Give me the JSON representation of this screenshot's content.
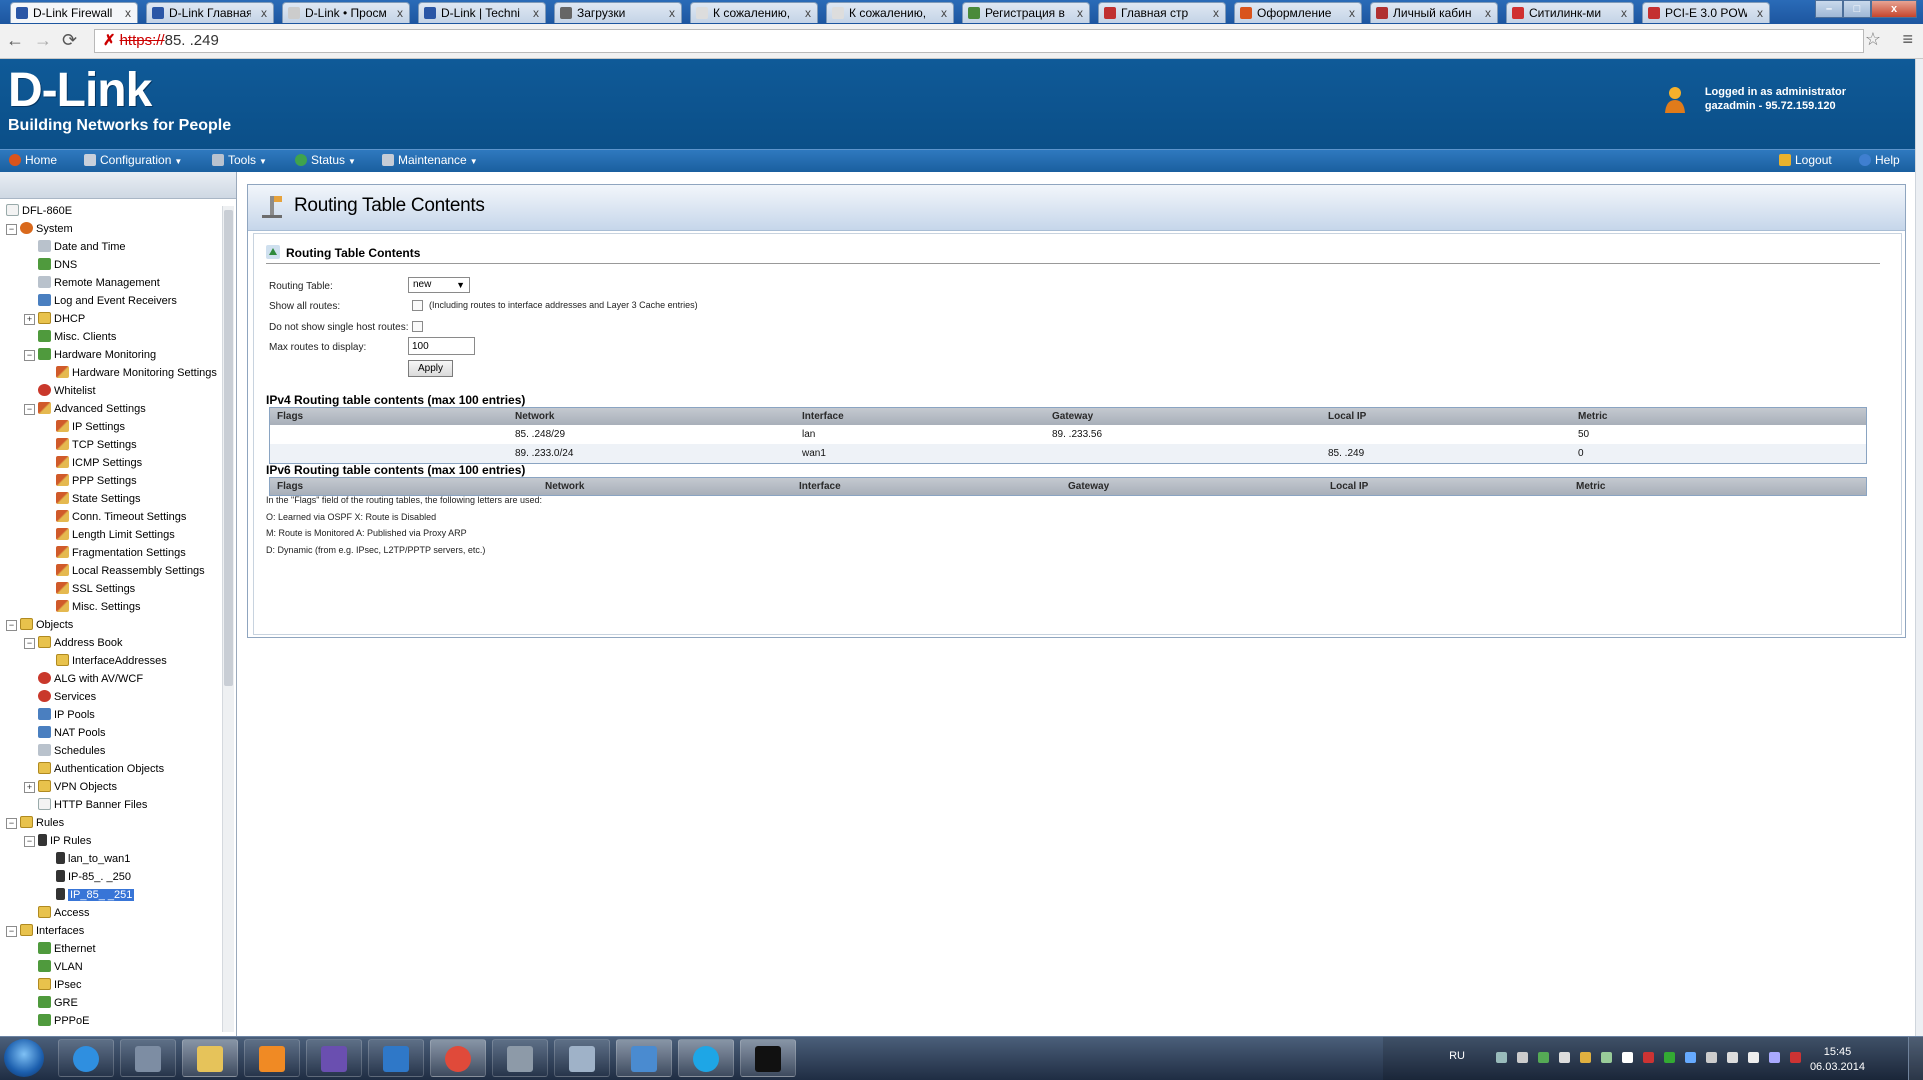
{
  "browser": {
    "tabs": [
      {
        "label": "D-Link Firewall",
        "active": true
      },
      {
        "label": "D-Link Главная"
      },
      {
        "label": "D-Link • Просм"
      },
      {
        "label": "D-Link | Techni"
      },
      {
        "label": "Загрузки"
      },
      {
        "label": "К сожалению,"
      },
      {
        "label": "К сожалению,"
      },
      {
        "label": "Регистрация в"
      },
      {
        "label": "Главная стр"
      },
      {
        "label": "Оформление"
      },
      {
        "label": "Личный кабин"
      },
      {
        "label": "Ситилинк-ми"
      },
      {
        "label": "PCI-E 3.0 POW"
      }
    ],
    "url_scheme": "https://",
    "url_host": "85.       .249",
    "close_glyph": "x",
    "win_min": "–",
    "win_max": "□",
    "win_close": "x"
  },
  "header": {
    "logo": "D-Link",
    "tagline": "Building Networks for People",
    "logged_in": "Logged in as administrator",
    "session": "gazadmin - 95.72.159.120"
  },
  "nav": {
    "home": "Home",
    "configuration": "Configuration",
    "tools": "Tools",
    "status": "Status",
    "maintenance": "Maintenance",
    "logout": "Logout",
    "help": "Help"
  },
  "tree": {
    "items": [
      {
        "label": "DFL-860E",
        "level": 0,
        "toggle": "",
        "icon": "icdoc"
      },
      {
        "label": "System",
        "level": 0,
        "toggle": "−",
        "icon": "icw"
      },
      {
        "label": "Date and Time",
        "level": 1,
        "toggle": "",
        "icon": "icg"
      },
      {
        "label": "DNS",
        "level": 1,
        "toggle": "",
        "icon": "icgr"
      },
      {
        "label": "Remote Management",
        "level": 1,
        "toggle": "",
        "icon": "icg"
      },
      {
        "label": "Log and Event Receivers",
        "level": 1,
        "toggle": "",
        "icon": "icb"
      },
      {
        "label": "DHCP",
        "level": 1,
        "toggle": "+",
        "icon": "icf"
      },
      {
        "label": "Misc. Clients",
        "level": 1,
        "toggle": "",
        "icon": "icgr"
      },
      {
        "label": "Hardware Monitoring",
        "level": 1,
        "toggle": "−",
        "icon": "icgr"
      },
      {
        "label": "Hardware Monitoring Settings",
        "level": 2,
        "toggle": "",
        "icon": "ics"
      },
      {
        "label": "Whitelist",
        "level": 1,
        "toggle": "",
        "icon": "icr"
      },
      {
        "label": "Advanced Settings",
        "level": 1,
        "toggle": "−",
        "icon": "ics"
      },
      {
        "label": "IP Settings",
        "level": 2,
        "toggle": "",
        "icon": "ics"
      },
      {
        "label": "TCP Settings",
        "level": 2,
        "toggle": "",
        "icon": "ics"
      },
      {
        "label": "ICMP Settings",
        "level": 2,
        "toggle": "",
        "icon": "ics"
      },
      {
        "label": "PPP Settings",
        "level": 2,
        "toggle": "",
        "icon": "ics"
      },
      {
        "label": "State Settings",
        "level": 2,
        "toggle": "",
        "icon": "ics"
      },
      {
        "label": "Conn. Timeout Settings",
        "level": 2,
        "toggle": "",
        "icon": "ics"
      },
      {
        "label": "Length Limit Settings",
        "level": 2,
        "toggle": "",
        "icon": "ics"
      },
      {
        "label": "Fragmentation Settings",
        "level": 2,
        "toggle": "",
        "icon": "ics"
      },
      {
        "label": "Local Reassembly Settings",
        "level": 2,
        "toggle": "",
        "icon": "ics"
      },
      {
        "label": "SSL Settings",
        "level": 2,
        "toggle": "",
        "icon": "ics"
      },
      {
        "label": "Misc. Settings",
        "level": 2,
        "toggle": "",
        "icon": "ics"
      },
      {
        "label": "Objects",
        "level": 0,
        "toggle": "−",
        "icon": "icf"
      },
      {
        "label": "Address Book",
        "level": 1,
        "toggle": "−",
        "icon": "icf"
      },
      {
        "label": "InterfaceAddresses",
        "level": 2,
        "toggle": "",
        "icon": "icf"
      },
      {
        "label": "ALG with AV/WCF",
        "level": 1,
        "toggle": "",
        "icon": "icr"
      },
      {
        "label": "Services",
        "level": 1,
        "toggle": "",
        "icon": "icr"
      },
      {
        "label": "IP Pools",
        "level": 1,
        "toggle": "",
        "icon": "icb"
      },
      {
        "label": "NAT Pools",
        "level": 1,
        "toggle": "",
        "icon": "icb"
      },
      {
        "label": "Schedules",
        "level": 1,
        "toggle": "",
        "icon": "icg"
      },
      {
        "label": "Authentication Objects",
        "level": 1,
        "toggle": "",
        "icon": "icf"
      },
      {
        "label": "VPN Objects",
        "level": 1,
        "toggle": "+",
        "icon": "icf"
      },
      {
        "label": "HTTP Banner Files",
        "level": 1,
        "toggle": "",
        "icon": "icdoc"
      },
      {
        "label": "Rules",
        "level": 0,
        "toggle": "−",
        "icon": "icf"
      },
      {
        "label": "IP Rules",
        "level": 1,
        "toggle": "−",
        "icon": "ictl"
      },
      {
        "label": "lan_to_wan1",
        "level": 2,
        "toggle": "",
        "icon": "ictl"
      },
      {
        "label": "IP-85_.       _250",
        "level": 2,
        "toggle": "",
        "icon": "ictl"
      },
      {
        "label": "IP_85_       _251",
        "level": 2,
        "toggle": "",
        "icon": "ictl",
        "selected": true
      },
      {
        "label": "Access",
        "level": 1,
        "toggle": "",
        "icon": "icf"
      },
      {
        "label": "Interfaces",
        "level": 0,
        "toggle": "−",
        "icon": "icf"
      },
      {
        "label": "Ethernet",
        "level": 1,
        "toggle": "",
        "icon": "icgr"
      },
      {
        "label": "VLAN",
        "level": 1,
        "toggle": "",
        "icon": "icgr"
      },
      {
        "label": "IPsec",
        "level": 1,
        "toggle": "",
        "icon": "icf"
      },
      {
        "label": "GRE",
        "level": 1,
        "toggle": "",
        "icon": "icgr"
      },
      {
        "label": "PPPoE",
        "level": 1,
        "toggle": "",
        "icon": "icgr"
      }
    ]
  },
  "page": {
    "title": "Routing Table Contents",
    "section_title": "Routing Table Contents",
    "form": {
      "routing_table_label": "Routing Table:",
      "routing_table_value": "new",
      "show_all_label": "Show all routes:",
      "show_all_hint": "(Including routes to interface addresses and Layer 3 Cache entries)",
      "no_single_host_label": "Do not show single host routes:",
      "max_routes_label": "Max routes to display:",
      "max_routes_value": "100",
      "apply_label": "Apply"
    },
    "ipv4": {
      "title": "IPv4 Routing table contents (max 100 entries)",
      "columns": [
        "Flags",
        "Network",
        "Interface",
        "Gateway",
        "Local IP",
        "Metric"
      ],
      "rows": [
        [
          "",
          "85.        .248/29",
          "lan",
          "89.        .233.56",
          "",
          "50"
        ],
        [
          "",
          "89.        .233.0/24",
          "wan1",
          "",
          "85.        .249",
          "0"
        ]
      ]
    },
    "ipv6": {
      "title": "IPv6 Routing table contents (max 100 entries)",
      "columns": [
        "Flags",
        "Network",
        "Interface",
        "Gateway",
        "Local IP",
        "Metric"
      ]
    },
    "notes": [
      "In the \"Flags\" field of the routing tables, the following letters are used:",
      "O: Learned via OSPF    X: Route is Disabled",
      "M: Route is Monitored    A: Published via Proxy ARP",
      "D: Dynamic (from e.g. IPsec, L2TP/PPTP servers, etc.)"
    ]
  },
  "taskbar": {
    "apps": [
      "ie",
      "network",
      "explorer",
      "media-player",
      "visual-studio",
      "publisher",
      "chrome",
      "remote",
      "calculator",
      "control-panel",
      "skype",
      "cmd"
    ],
    "lang": "RU",
    "time": "15:45",
    "date": "06.03.2014"
  }
}
